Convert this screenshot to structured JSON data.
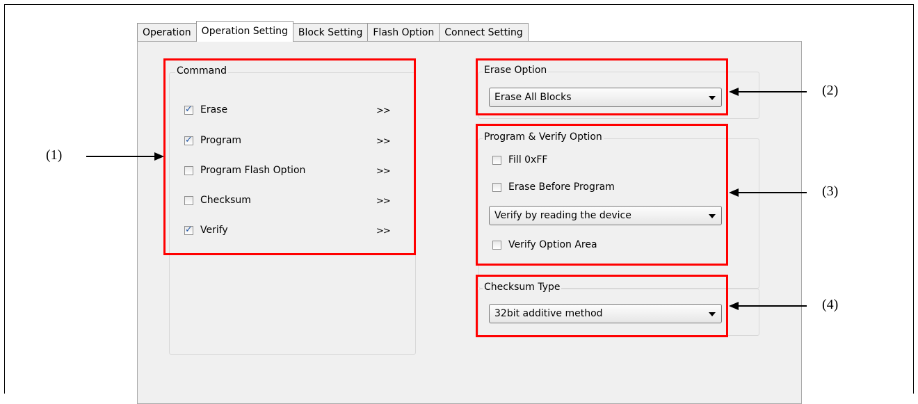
{
  "tabs": [
    "Operation",
    "Operation Setting",
    "Block Setting",
    "Flash Option",
    "Connect Setting"
  ],
  "active_tab": "Operation Setting",
  "command": {
    "title": "Command",
    "items": [
      {
        "label": "Erase",
        "checked": true,
        "more": ">>"
      },
      {
        "label": "Program",
        "checked": true,
        "more": ">>"
      },
      {
        "label": "Program Flash Option",
        "checked": false,
        "more": ">>"
      },
      {
        "label": "Checksum",
        "checked": false,
        "more": ">>"
      },
      {
        "label": "Verify",
        "checked": true,
        "more": ">>"
      }
    ]
  },
  "erase_option": {
    "title": "Erase Option",
    "value": "Erase All Blocks"
  },
  "program_verify": {
    "title": "Program & Verify Option",
    "fill": {
      "label": "Fill 0xFF",
      "checked": false
    },
    "erase_before": {
      "label": "Erase Before Program",
      "checked": false
    },
    "verify_select": "Verify by reading the device",
    "verify_option_area": {
      "label": "Verify Option Area",
      "checked": false
    }
  },
  "checksum_type": {
    "title": "Checksum Type",
    "value": "32bit additive method"
  },
  "callouts": {
    "c1": "(1)",
    "c2": "(2)",
    "c3": "(3)",
    "c4": "(4)"
  },
  "colors": {
    "highlight": "#ff0000",
    "panel": "#f0f0f0",
    "check": "#2156a5"
  }
}
